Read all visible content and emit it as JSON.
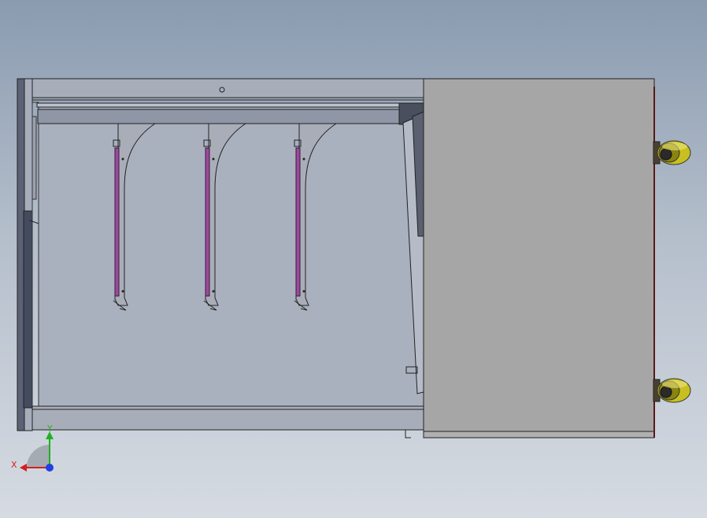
{
  "view": {
    "background_top": "#8a9bb0",
    "background_bottom": "#d6dbe2"
  },
  "triad": {
    "x_label": "X",
    "y_label": "Y",
    "x_color": "#d42020",
    "y_color": "#20b020",
    "z_color": "#2040e0"
  },
  "colors": {
    "steel": "#a6a6a6",
    "bracket": "#a9adb8",
    "strip": "#9a4a9c",
    "wheel": "#c8c020"
  },
  "brackets": [
    {
      "name": "bracket-1"
    },
    {
      "name": "bracket-2"
    },
    {
      "name": "bracket-3"
    }
  ],
  "casters": [
    {
      "name": "caster-top"
    },
    {
      "name": "caster-bottom"
    }
  ]
}
